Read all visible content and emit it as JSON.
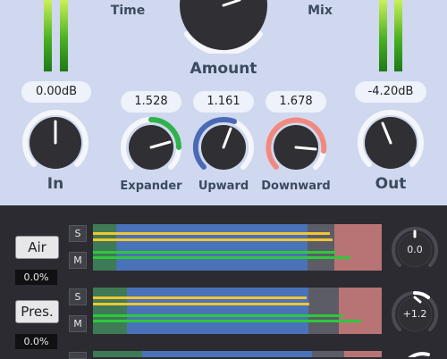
{
  "header": {
    "time_label": "Time",
    "mix_label": "Mix",
    "amount_label": "Amount"
  },
  "input": {
    "label": "In",
    "value": "0.00dB"
  },
  "output": {
    "label": "Out",
    "value": "-4.20dB"
  },
  "ratios": [
    {
      "label": "Expander",
      "value": "1.528",
      "accent": "#2fb24a"
    },
    {
      "label": "Upward",
      "value": "1.161",
      "accent": "#4a6ab5"
    },
    {
      "label": "Downward",
      "value": "1.678",
      "accent": "#f08a80"
    }
  ],
  "bands": [
    {
      "name": "Air",
      "percent": "0.0%",
      "solo": "S",
      "mute": "M",
      "gain": "0.0"
    },
    {
      "name": "Pres.",
      "percent": "0.0%",
      "solo": "S",
      "mute": "M",
      "gain": "+1.2"
    }
  ],
  "colors": {
    "panel_top": "#cfd8ee",
    "panel_bottom": "#2b2b31",
    "knob": "#2f2f34",
    "meter_green": "#49b023",
    "strip_blue": "#4a72b8",
    "strip_red": "#b87474",
    "line_yellow": "#f2c531",
    "line_green": "#2ec83c"
  }
}
